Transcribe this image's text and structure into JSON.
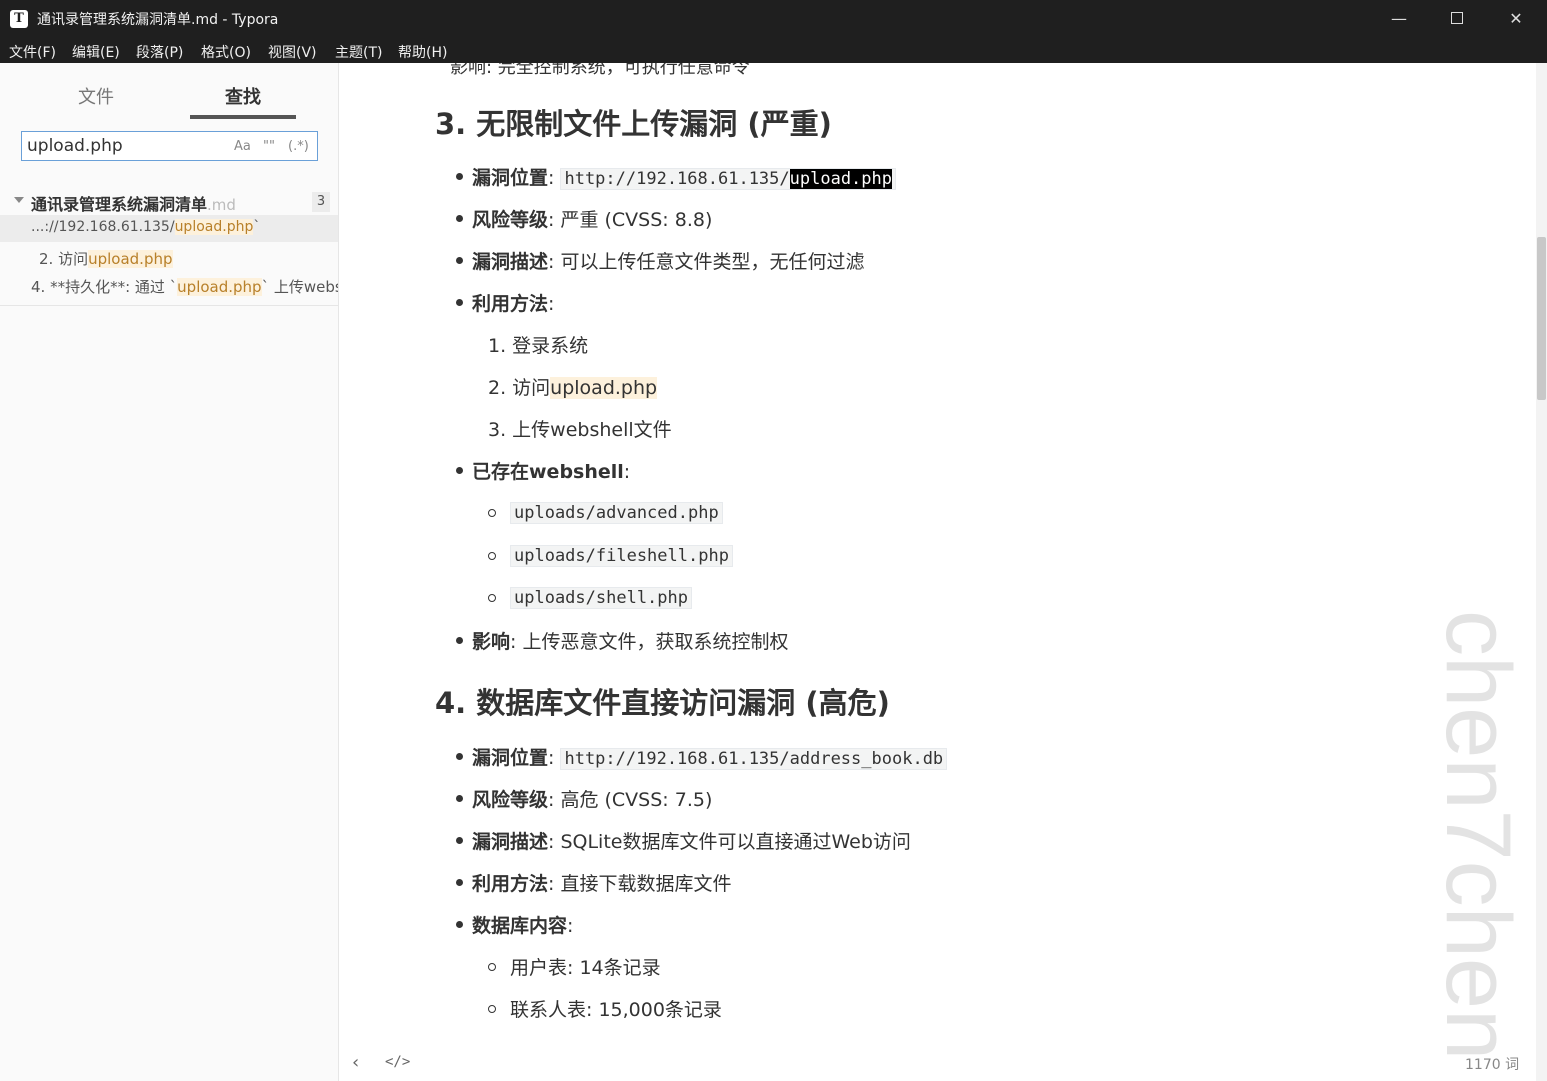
{
  "window": {
    "title": "通讯录管理系统漏洞清单.md - Typora",
    "app_icon_letter": "T",
    "minimize_label": "—",
    "close_label": "✕"
  },
  "menu": [
    "文件(F)",
    "编辑(E)",
    "段落(P)",
    "格式(O)",
    "视图(V)",
    "主题(T)",
    "帮助(H)"
  ],
  "sidebar": {
    "tabs": [
      "文件",
      "查找"
    ],
    "active_tab": "查找",
    "search": {
      "value": "upload.php",
      "case_label": "Aa",
      "word_label": "\"\"",
      "regex_label": "(.*)"
    },
    "group": {
      "name": "通讯录管理系统漏洞清单",
      "ext": ".md",
      "count": "3"
    },
    "results": [
      {
        "before": "...://192.168.61.135/",
        "match": "upload.php",
        "after": "`"
      },
      {
        "before": "2. 访问",
        "match": "upload.php",
        "after": ""
      },
      {
        "before": "4. **持久化**: 通过 `",
        "match": "upload.php",
        "after": "` 上传websh"
      }
    ]
  },
  "document": {
    "cut_line": "影响: 完全控制系统，可执行任意命令",
    "section3": {
      "heading": "3. 无限制文件上传漏洞 (严重)",
      "location_label": "漏洞位置",
      "location_prefix": "http://192.168.61.135/",
      "location_match": "upload.php",
      "risk_label": "风险等级",
      "risk_value": ": 严重 (CVSS: 8.8)",
      "desc_label": "漏洞描述",
      "desc_value": ": 可以上传任意文件类型，无任何过滤",
      "method_label": "利用方法",
      "steps": [
        "1. 登录系统",
        "2. 访问",
        "3. 上传webshell文件"
      ],
      "step2_match": "upload.php",
      "webshell_label": "已存在webshell",
      "webshells": [
        "uploads/advanced.php",
        "uploads/fileshell.php",
        "uploads/shell.php"
      ],
      "impact_label": "影响",
      "impact_value": ": 上传恶意文件，获取系统控制权"
    },
    "section4": {
      "heading": "4. 数据库文件直接访问漏洞 (高危)",
      "location_label": "漏洞位置",
      "location_code": "http://192.168.61.135/address_book.db",
      "risk_label": "风险等级",
      "risk_value": ": 高危 (CVSS: 7.5)",
      "desc_label": "漏洞描述",
      "desc_value": ": SQLite数据库文件可以直接通过Web访问",
      "method_label": "利用方法",
      "method_value": ": 直接下载数据库文件",
      "content_label": "数据库内容",
      "contents": [
        "用户表: 14条记录",
        "联系人表: 15,000条记录"
      ]
    }
  },
  "watermark": "chen7chen",
  "status": {
    "word_count": "1170 词"
  }
}
